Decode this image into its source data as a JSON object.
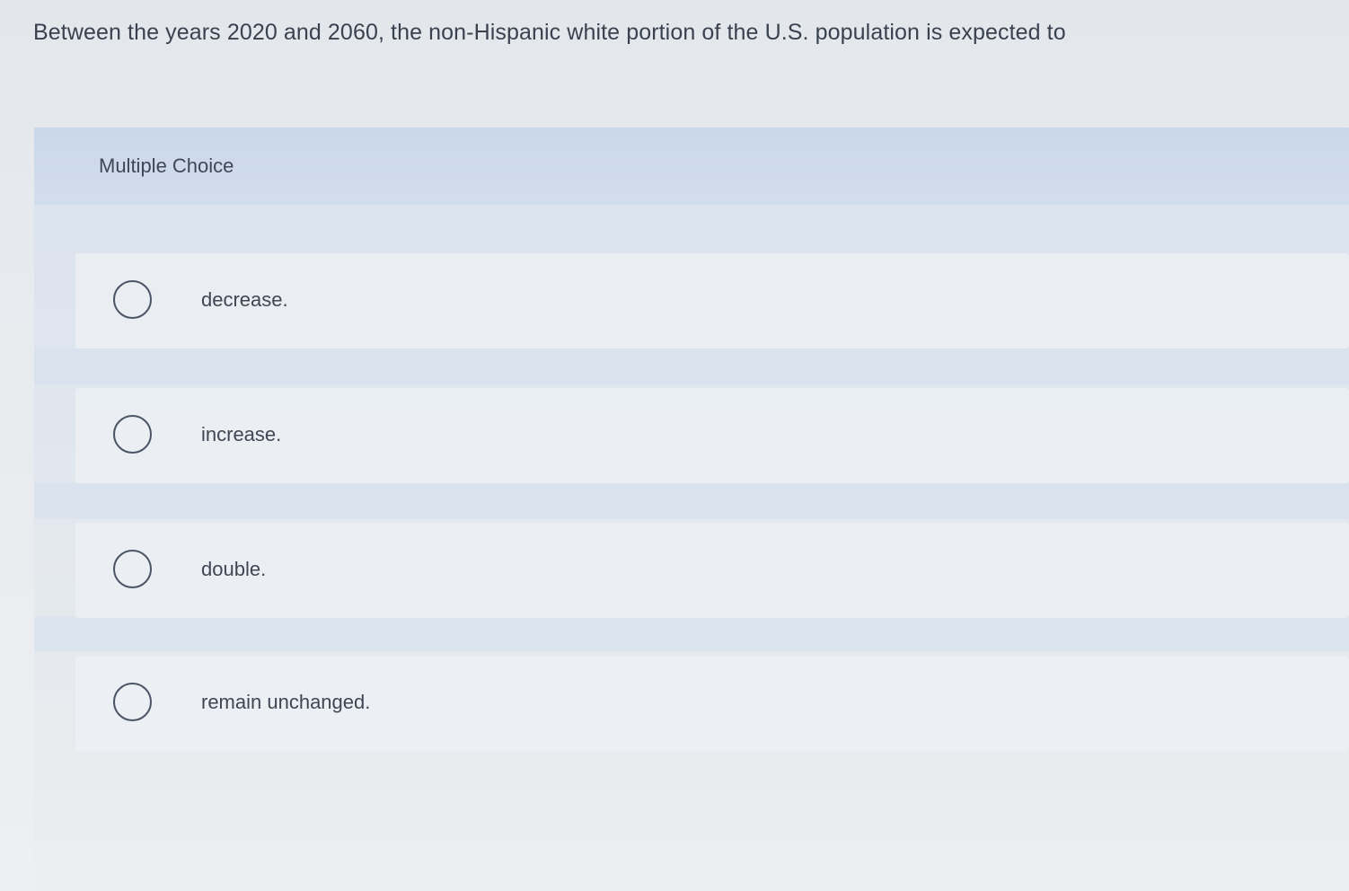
{
  "question": {
    "text": "Between the years 2020 and 2060, the non-Hispanic white portion of the U.S. population is expected to"
  },
  "multiple_choice": {
    "header_label": "Multiple Choice",
    "options": [
      {
        "label": "decrease.",
        "selected": false
      },
      {
        "label": "increase.",
        "selected": false
      },
      {
        "label": "double.",
        "selected": false
      },
      {
        "label": "remain unchanged.",
        "selected": false
      }
    ]
  }
}
